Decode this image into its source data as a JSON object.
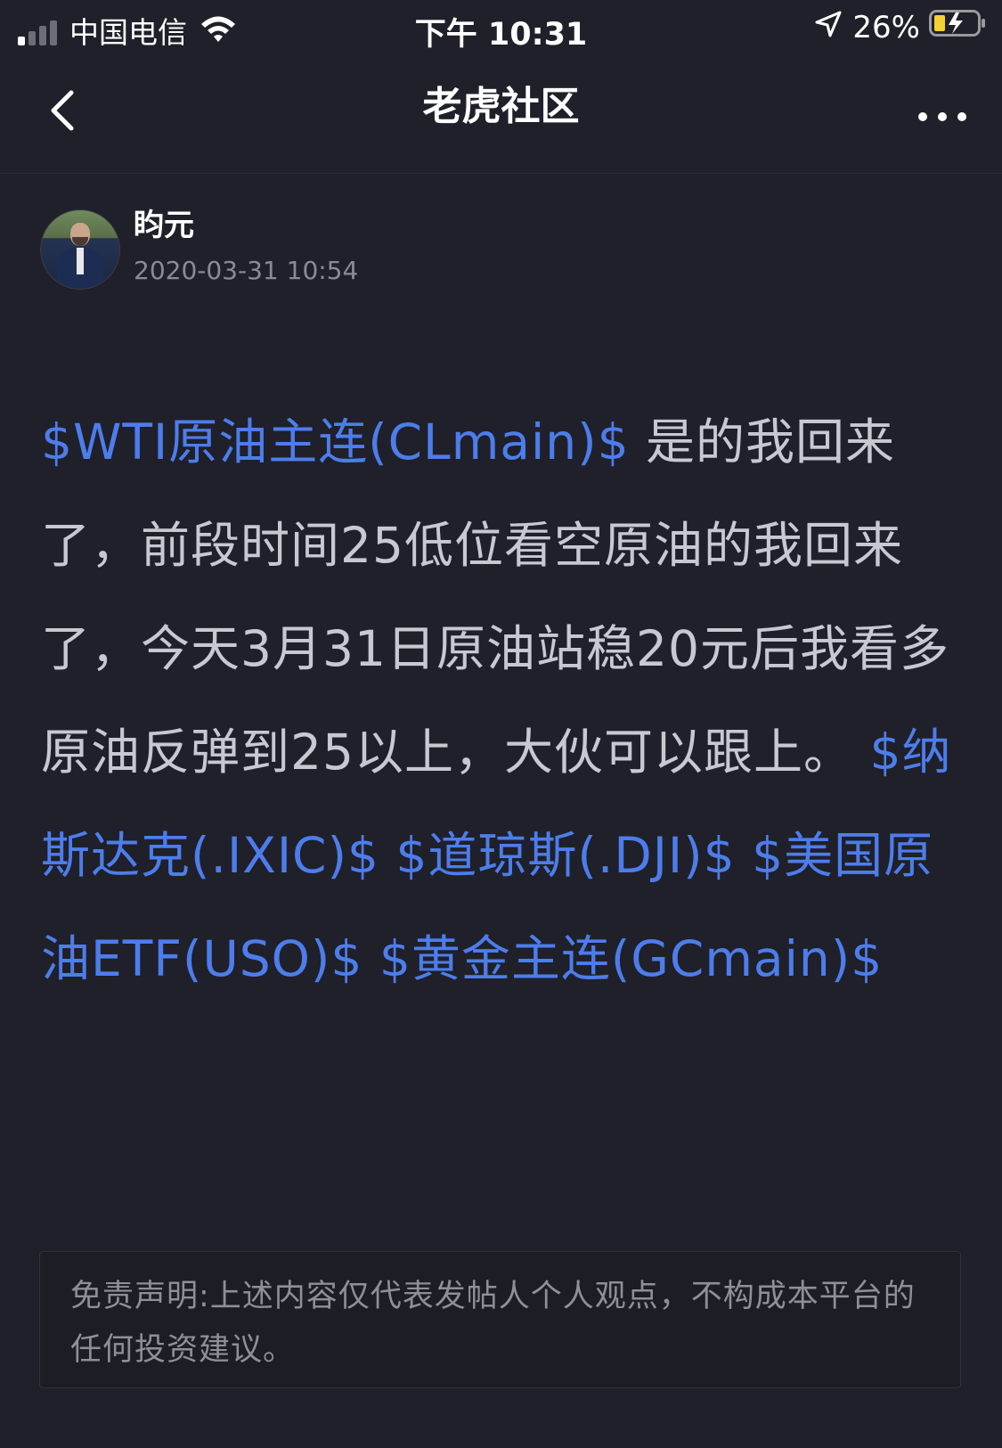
{
  "status_bar": {
    "carrier": "中国电信",
    "time": "下午 10:31",
    "battery_percent": "26%",
    "signal_bars": 4,
    "signal_bars_active": 1
  },
  "nav": {
    "title": "老虎社区"
  },
  "author": {
    "name": "盷元",
    "post_time": "2020-03-31 10:54"
  },
  "post": {
    "segments": [
      {
        "type": "link",
        "text": "$WTI原油主连(CLmain)$"
      },
      {
        "type": "text",
        "text": " 是的我回来了，前段时间25低位看空原油的我回来了，今天3月31日原油站稳20元后我看多原油反弹到25以上，大伙可以跟上。 "
      },
      {
        "type": "link",
        "text": "$纳斯达克(.IXIC)$"
      },
      {
        "type": "text",
        "text": " "
      },
      {
        "type": "link",
        "text": "$道琼斯(.DJI)$"
      },
      {
        "type": "text",
        "text": " "
      },
      {
        "type": "link",
        "text": "$美国原油ETF(USO)$"
      },
      {
        "type": "text",
        "text": " "
      },
      {
        "type": "link",
        "text": "$黄金主连(GCmain)$"
      }
    ]
  },
  "disclaimer": "免责声明:上述内容仅代表发帖人个人观点，不构成本平台的任何投资建议。",
  "colors": {
    "background": "#1f2029",
    "link": "#4d7dec",
    "body_text": "#c8c9d0",
    "muted": "#8a8b93"
  }
}
